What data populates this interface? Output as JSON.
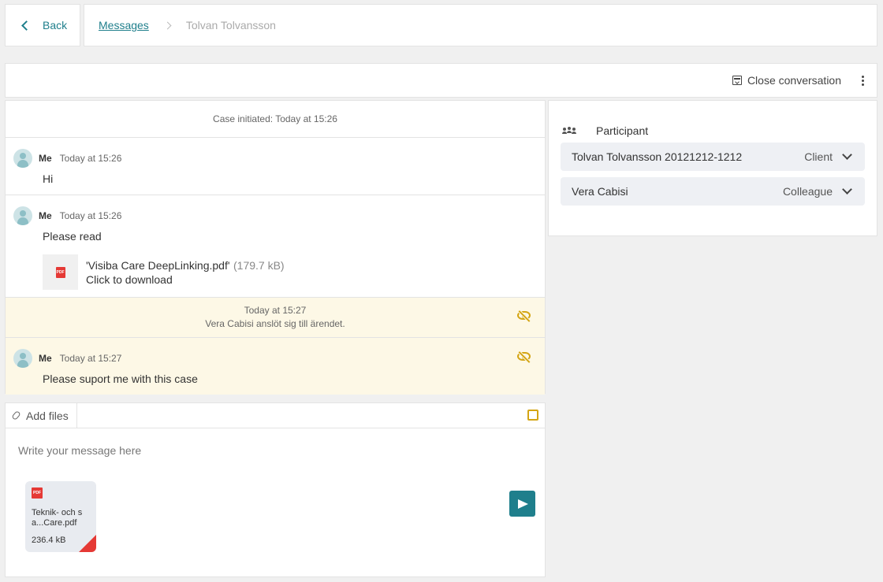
{
  "nav": {
    "back_label": "Back"
  },
  "breadcrumb": {
    "parent": "Messages",
    "current": "Tolvan Tolvansson"
  },
  "toolbar": {
    "close_label": "Close conversation"
  },
  "conversation": {
    "initiated": "Case initiated: Today at 15:26",
    "messages": [
      {
        "sender": "Me",
        "time": "Today at 15:26",
        "text": "Hi"
      },
      {
        "sender": "Me",
        "time": "Today at 15:26",
        "text": "Please read",
        "attachment": {
          "name": "'Visiba Care DeepLinking.pdf'",
          "size": "(179.7 kB)",
          "cta": "Click to download",
          "type": "PDF"
        }
      },
      {
        "sender": "Me",
        "time": "Today at 15:27",
        "text": "Please suport me with this case"
      }
    ],
    "event": {
      "time": "Today at 15:27",
      "text": "Vera Cabisi anslöt sig till ärendet."
    }
  },
  "composer": {
    "add_files_label": "Add files",
    "placeholder": "Write your message here",
    "upload": {
      "type": "PDF",
      "name": "Teknik- och s a...Care.pdf",
      "size": "236.4 kB"
    }
  },
  "participants": {
    "title": "Participant",
    "items": [
      {
        "name": "Tolvan Tolvansson  20121212-1212",
        "role": "Client"
      },
      {
        "name": "Vera Cabisi",
        "role": "Colleague"
      }
    ]
  },
  "colors": {
    "accent": "#1f7f8c",
    "internal_note_bg": "#fdf8e6",
    "hidden_icon": "#d4a514",
    "pdf": "#e53935"
  }
}
